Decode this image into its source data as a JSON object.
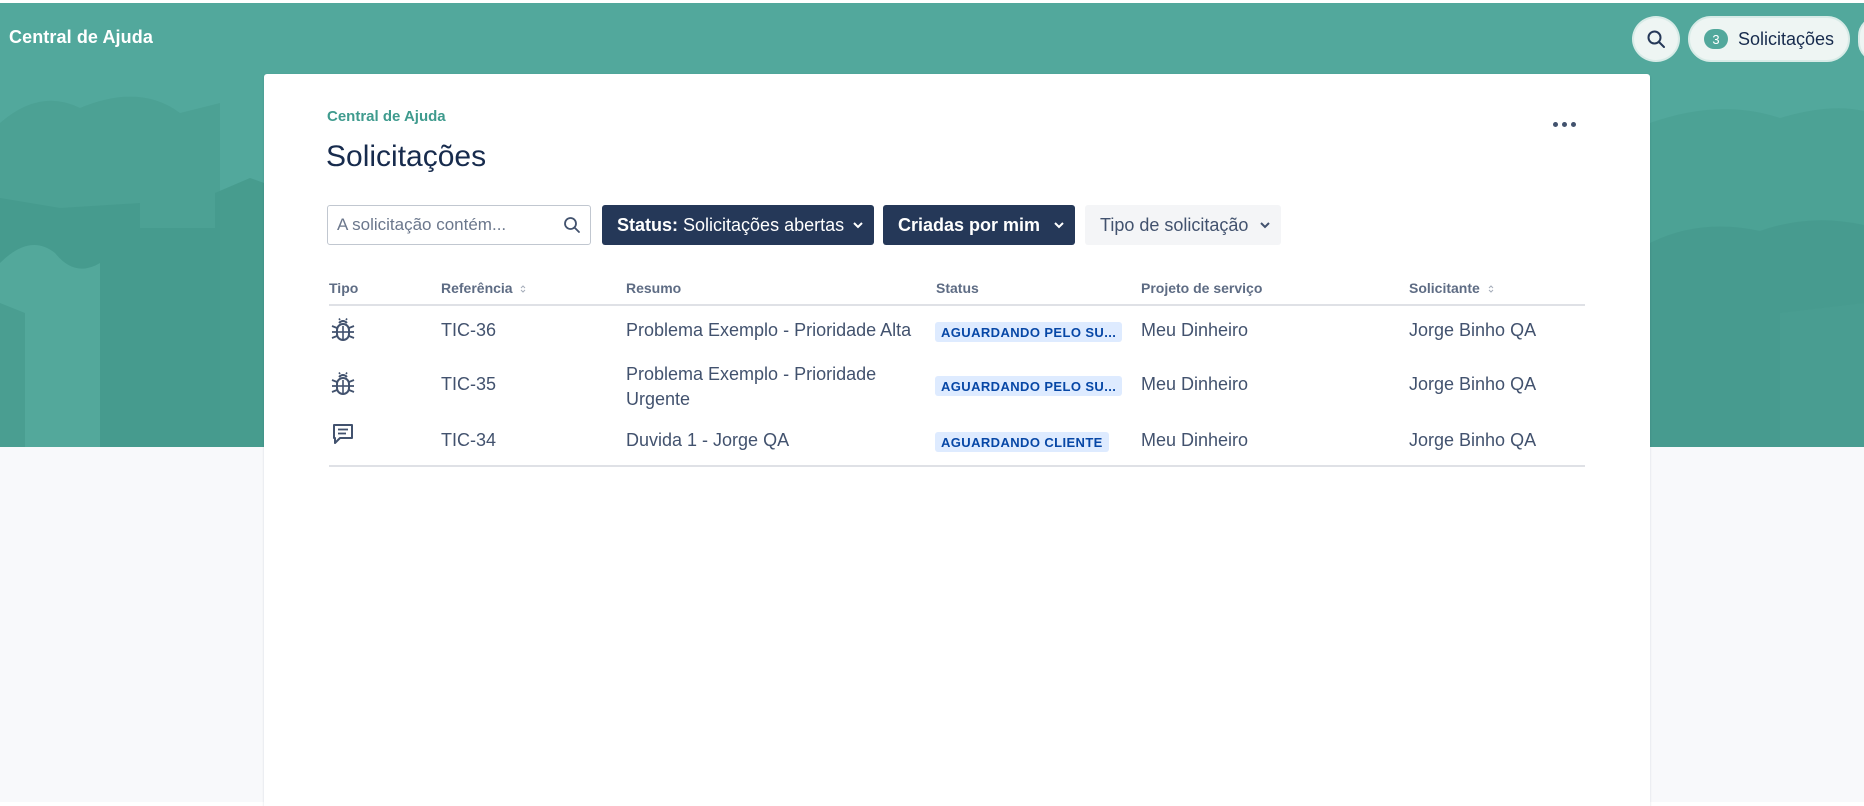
{
  "header": {
    "brand": "Central de Ajuda",
    "requests_count": "3",
    "requests_label": "Solicitações"
  },
  "page": {
    "breadcrumb": "Central de Ajuda",
    "title": "Solicitações"
  },
  "filters": {
    "search_placeholder": "A solicitação contém...",
    "status_prefix": "Status:",
    "status_value": "Solicitações abertas",
    "created_by": "Criadas por mim",
    "request_type": "Tipo de solicitação"
  },
  "table": {
    "columns": [
      "Tipo",
      "Referência",
      "Resumo",
      "Status",
      "Projeto de serviço",
      "Solicitante"
    ],
    "rows": [
      {
        "type_icon": "bug-icon",
        "reference": "TIC-36",
        "summary": "Problema Exemplo - Prioridade Alta",
        "status": "AGUARDANDO PELO SU...",
        "project": "Meu Dinheiro",
        "requester": "Jorge Binho QA"
      },
      {
        "type_icon": "bug-icon",
        "reference": "TIC-35",
        "summary": "Problema Exemplo - Prioridade Urgente",
        "status": "AGUARDANDO PELO SU...",
        "project": "Meu Dinheiro",
        "requester": "Jorge Binho QA"
      },
      {
        "type_icon": "comment-icon",
        "reference": "TIC-34",
        "summary": "Duvida 1 - Jorge QA",
        "status": "AGUARDANDO CLIENTE",
        "project": "Meu Dinheiro",
        "requester": "Jorge Binho QA"
      }
    ]
  },
  "colors": {
    "banner": "#52a89c",
    "accent": "#3f9b8e",
    "dark_button": "#253858",
    "lozenge_bg": "#deebff",
    "lozenge_text": "#0747a6"
  }
}
